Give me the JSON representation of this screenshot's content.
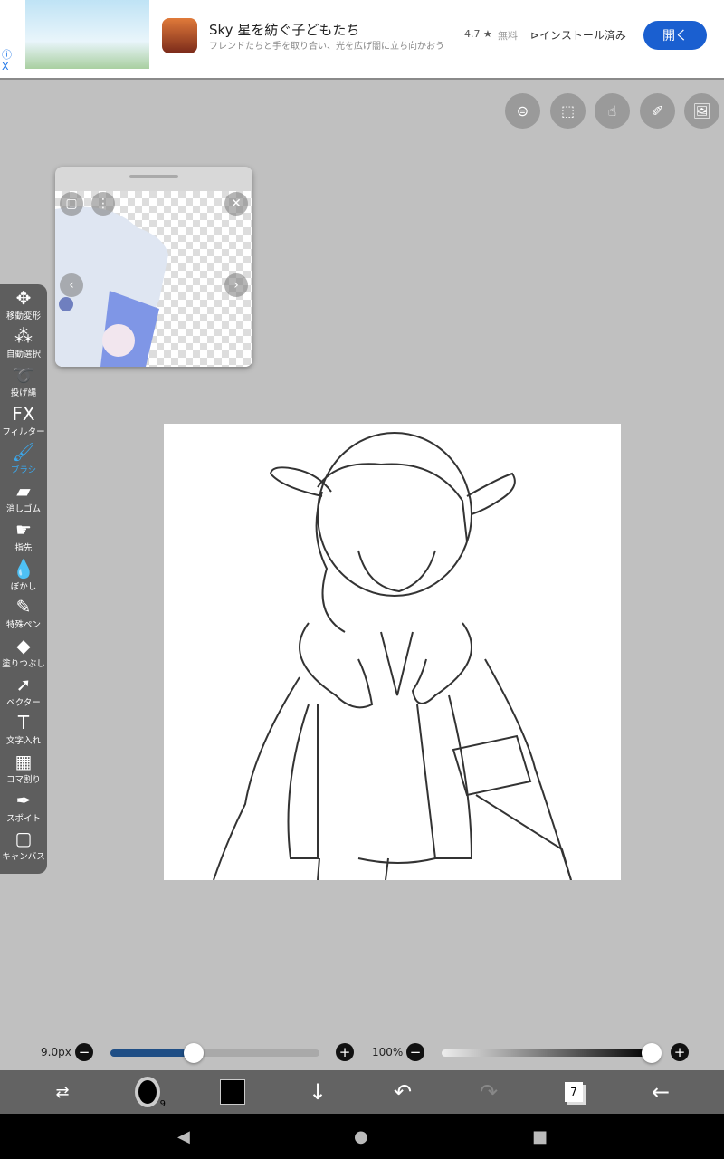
{
  "ad": {
    "title": "Sky 星を紡ぐ子どもたち",
    "subtitle": "フレンドたちと手を取り合い、光を広げ闇に立ち向かおう",
    "rating": "4.7 ★",
    "price": "無料",
    "installed": "インストール済み",
    "open": "開く",
    "info": "ⓘ",
    "close": "X"
  },
  "tools": [
    {
      "icon": "✥",
      "label": "移動変形"
    },
    {
      "icon": "⁂",
      "label": "自動選択"
    },
    {
      "icon": "➰",
      "label": "投げ縄"
    },
    {
      "icon": "FX",
      "label": "フィルター"
    },
    {
      "icon": "🖌",
      "label": "ブラシ",
      "active": true
    },
    {
      "icon": "▰",
      "label": "消しゴム"
    },
    {
      "icon": "☛",
      "label": "指先"
    },
    {
      "icon": "💧",
      "label": "ぼかし"
    },
    {
      "icon": "✎",
      "label": "特殊ペン"
    },
    {
      "icon": "◆",
      "label": "塗りつぶし"
    },
    {
      "icon": "➚",
      "label": "ベクター"
    },
    {
      "icon": "T",
      "label": "文字入れ"
    },
    {
      "icon": "▦",
      "label": "コマ割り"
    },
    {
      "icon": "✒",
      "label": "スポイト"
    },
    {
      "icon": "▢",
      "label": "キャンバス"
    }
  ],
  "brush": {
    "size_label": "9.0px",
    "size_fraction": 0.4,
    "opacity_label": "100%",
    "opacity_fraction": 1.0
  },
  "bottom": {
    "brush_size_badge": "9",
    "layer_count": "7",
    "color": "#000000"
  },
  "colors": {
    "accent": "#3aa8ee",
    "slider": "#1f4e85"
  }
}
